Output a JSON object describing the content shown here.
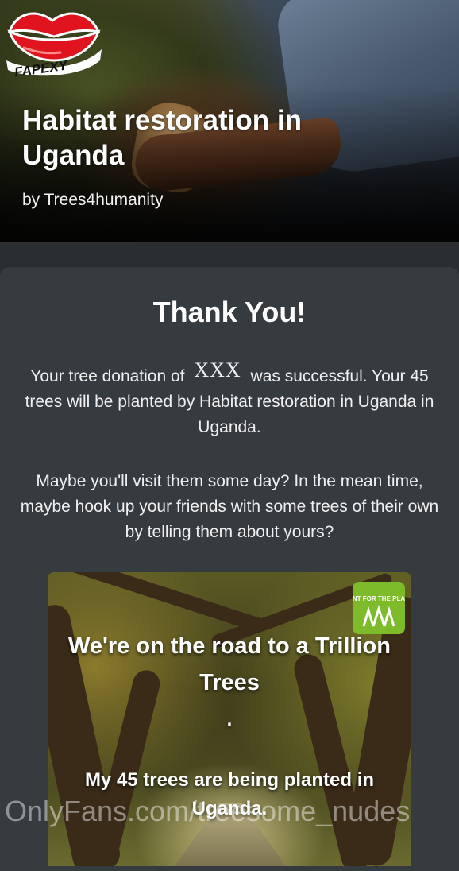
{
  "hero": {
    "title": "Habitat restoration in Uganda",
    "byline": "by Trees4humanity"
  },
  "logo": {
    "brand_text": "FAPEXY",
    "icon": "lips-icon"
  },
  "card": {
    "heading": "Thank You!",
    "paragraph1": {
      "before": "Your tree donation of",
      "redacted": "XXX",
      "after": "was successful. Your 45 trees will be planted by Habitat restoration in Uganda in Uganda."
    },
    "paragraph2": "Maybe you'll visit them some day? In the mean time, maybe hook up your friends with some trees of their own by telling them about yours?"
  },
  "share_image": {
    "logo_text": "PLANT FOR THE PLANET",
    "headline": "We're on the road to a Trillion Trees",
    "dot": ".",
    "subline": "My 45 trees are being planted in Uganda."
  },
  "watermark": "OnlyFans.com/treesome_nudes",
  "colors": {
    "page_bg": "#2b2e31",
    "card_bg": "#363b40",
    "text": "#ffffff",
    "logo_red": "#e0141e",
    "p4p_green": "#7dbb2a"
  }
}
